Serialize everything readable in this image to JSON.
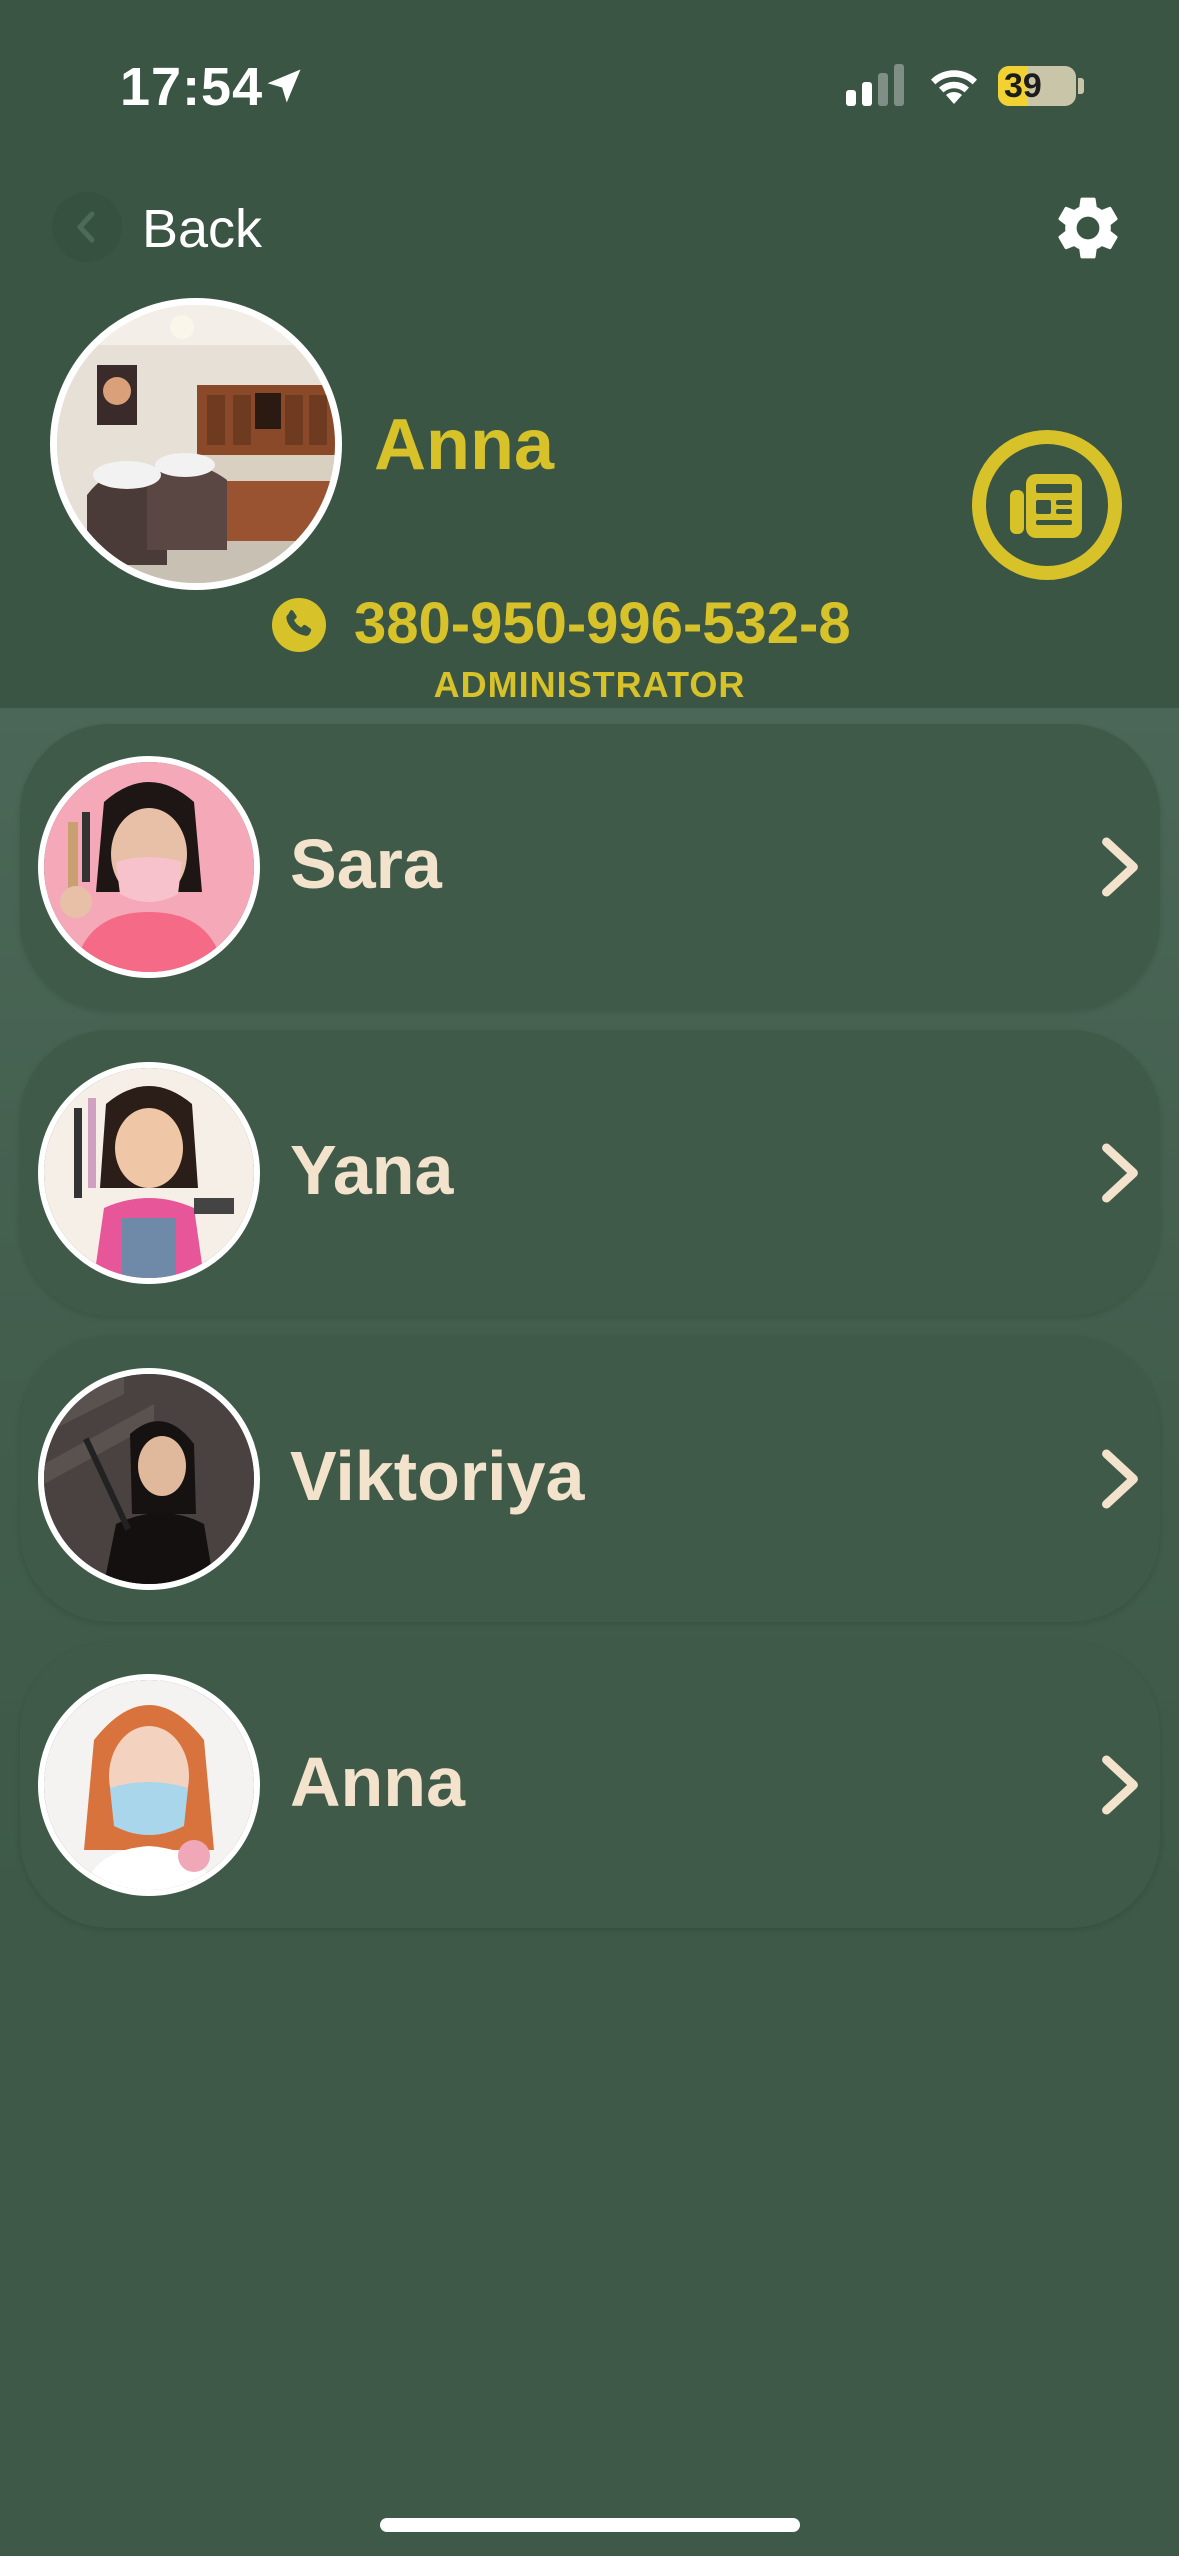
{
  "status_bar": {
    "time": "17:54",
    "battery_level": "39",
    "battery_fraction": 0.39,
    "icons": [
      "location-arrow-icon",
      "signal-icon",
      "wifi-icon",
      "battery-charging-icon"
    ]
  },
  "nav": {
    "back_label": "Back",
    "settings_icon": "gear-icon"
  },
  "profile": {
    "name": "Anna",
    "phone": "380-950-996-532-8",
    "role": "ADMINISTRATOR",
    "news_icon": "newspaper-icon"
  },
  "staff": [
    {
      "name": "Sara"
    },
    {
      "name": "Yana"
    },
    {
      "name": "Viktoriya"
    },
    {
      "name": "Anna"
    }
  ],
  "colors": {
    "background": "#3f5a49",
    "accent": "#d8c22a",
    "card_text": "#f4e3cc",
    "card": "#3f5a48"
  }
}
